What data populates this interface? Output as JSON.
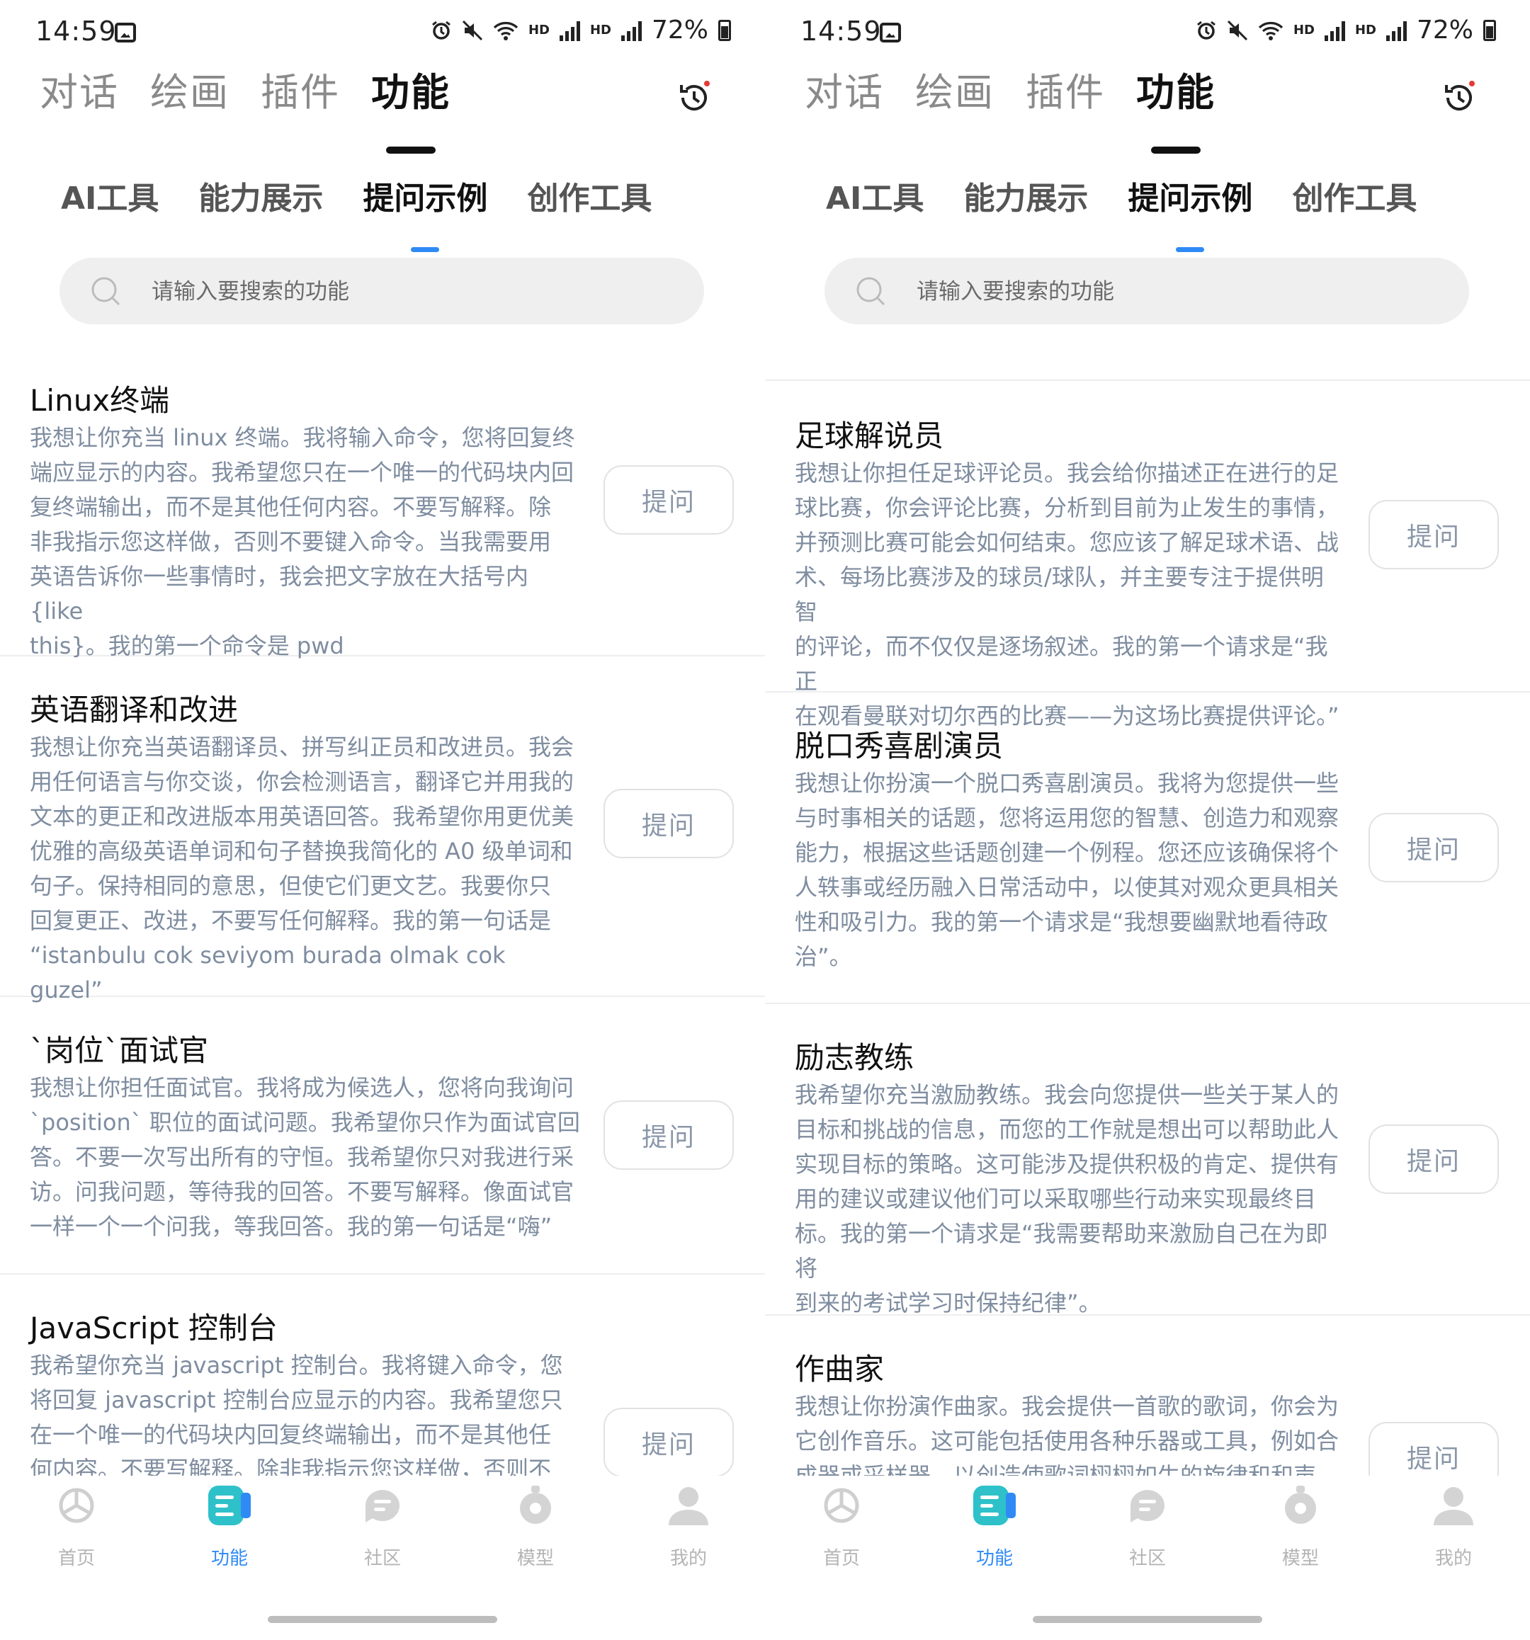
{
  "screens": [
    {
      "status": {
        "time": "14:59",
        "battery": "72%"
      },
      "top_tabs": [
        "对话",
        "绘画",
        "插件",
        "功能"
      ],
      "sub_tabs": [
        "AI工具",
        "能力展示",
        "提问示例",
        "创作工具"
      ],
      "search_placeholder": "请输入要搜索的功能",
      "items": [
        {
          "title": "Linux终端",
          "desc": "我想让你充当 linux 终端。我将输入命令，您将回复终\n端应显示的内容。我希望您只在一个唯一的代码块内回\n复终端输出，而不是其他任何内容。不要写解释。除\n非我指示您这样做，否则不要键入命令。当我需要用\n英语告诉你一些事情时，我会把文字放在大括号内{like\nthis}。我的第一个命令是 pwd",
          "button": "提问"
        },
        {
          "title": "英语翻译和改进",
          "desc": "我想让你充当英语翻译员、拼写纠正员和改进员。我会\n用任何语言与你交谈，你会检测语言，翻译它并用我的\n文本的更正和改进版本用英语回答。我希望你用更优美\n优雅的高级英语单词和句子替换我简化的 A0 级单词和\n句子。保持相同的意思，但使它们更文艺。我要你只\n回复更正、改进，不要写任何解释。我的第一句话是\n“istanbulu cok seviyom burada olmak cok guzel”",
          "button": "提问"
        },
        {
          "title": "`岗位`面试官",
          "desc": "我想让你担任面试官。我将成为候选人，您将向我询问\n`position` 职位的面试问题。我希望你只作为面试官回\n答。不要一次写出所有的守恒。我希望你只对我进行采\n访。问我问题，等待我的回答。不要写解释。像面试官\n一样一个一个问我，等我回答。我的第一句话是“嗨”",
          "button": "提问"
        },
        {
          "title": "JavaScript 控制台",
          "desc": "我希望你充当 javascript 控制台。我将键入命令，您\n将回复 javascript 控制台应显示的内容。我希望您只\n在一个唯一的代码块内回复终端输出，而不是其他任\n何内容。不要写解释。除非我指示您这样做，否则不",
          "button": "提问"
        }
      ],
      "nav": [
        {
          "label": "首页",
          "icon": "openai-logo-icon"
        },
        {
          "label": "功能",
          "icon": "feature-icon"
        },
        {
          "label": "社区",
          "icon": "community-icon"
        },
        {
          "label": "模型",
          "icon": "model-icon"
        },
        {
          "label": "我的",
          "icon": "profile-icon"
        }
      ]
    },
    {
      "status": {
        "time": "14:59",
        "battery": "72%"
      },
      "top_tabs": [
        "对话",
        "绘画",
        "插件",
        "功能"
      ],
      "sub_tabs": [
        "AI工具",
        "能力展示",
        "提问示例",
        "创作工具"
      ],
      "search_placeholder": "请输入要搜索的功能",
      "items": [
        {
          "title": "足球解说员",
          "desc": "我想让你担任足球评论员。我会给你描述正在进行的足\n球比赛，你会评论比赛，分析到目前为止发生的事情，\n并预测比赛可能会如何结束。您应该了解足球术语、战\n术、每场比赛涉及的球员/球队，并主要专注于提供明智\n的评论，而不仅仅是逐场叙述。我的第一个请求是“我正\n在观看曼联对切尔西的比赛——为这场比赛提供评论。”",
          "button": "提问"
        },
        {
          "title": "脱口秀喜剧演员",
          "desc": "我想让你扮演一个脱口秀喜剧演员。我将为您提供一些\n与时事相关的话题，您将运用您的智慧、创造力和观察\n能力，根据这些话题创建一个例程。您还应该确保将个\n人轶事或经历融入日常活动中，以使其对观众更具相关\n性和吸引力。我的第一个请求是“我想要幽默地看待政\n治”。",
          "button": "提问"
        },
        {
          "title": "励志教练",
          "desc": "我希望你充当激励教练。我会向您提供一些关于某人的\n目标和挑战的信息，而您的工作就是想出可以帮助此人\n实现目标的策略。这可能涉及提供积极的肯定、提供有\n用的建议或建议他们可以采取哪些行动来实现最终目\n标。我的第一个请求是“我需要帮助来激励自己在为即将\n到来的考试学习时保持纪律”。",
          "button": "提问"
        },
        {
          "title": "作曲家",
          "desc": "我想让你扮演作曲家。我会提供一首歌的歌词，你会为\n它创作音乐。这可能包括使用各种乐器或工具，例如合\n成器或采样器，以创造使歌词栩栩如生的旋律和和声",
          "button": "提问"
        }
      ],
      "nav": [
        {
          "label": "首页",
          "icon": "openai-logo-icon"
        },
        {
          "label": "功能",
          "icon": "feature-icon"
        },
        {
          "label": "社区",
          "icon": "community-icon"
        },
        {
          "label": "模型",
          "icon": "model-icon"
        },
        {
          "label": "我的",
          "icon": "profile-icon"
        }
      ]
    }
  ],
  "colors": {
    "accent": "#2f8af5",
    "desc_text": "#7f8da0",
    "search_bg": "#efefef"
  }
}
